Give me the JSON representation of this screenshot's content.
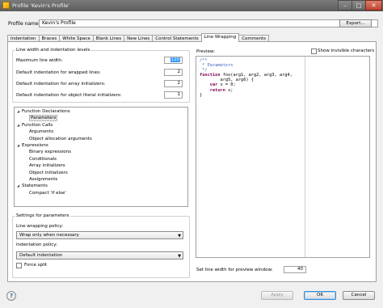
{
  "window": {
    "title": "Profile 'Kevin's Profile'",
    "min_glyph": "–",
    "max_glyph": "□",
    "close_glyph": "✕"
  },
  "profile": {
    "label": "Profile name:",
    "value": "Kevin's Profile",
    "export_label": "Export..."
  },
  "tabs": [
    {
      "label": "Indentation"
    },
    {
      "label": "Braces"
    },
    {
      "label": "White Space"
    },
    {
      "label": "Blank Lines"
    },
    {
      "label": "New Lines"
    },
    {
      "label": "Control Statements"
    },
    {
      "label": "Line Wrapping",
      "active": true
    },
    {
      "label": "Comments"
    }
  ],
  "line_width_group": {
    "title": "Line width and indentation levels",
    "rows": [
      {
        "label": "Maximum line width:",
        "value": "120"
      },
      {
        "label": "Default indentation for wrapped lines:",
        "value": "2"
      },
      {
        "label": "Default indentation for array initializers:",
        "value": "2"
      },
      {
        "label": "Default indentation for object literal initializers:",
        "value": "1"
      }
    ]
  },
  "tree": {
    "nodes": [
      {
        "label": "Function Declarations",
        "level": 0,
        "expanded": true
      },
      {
        "label": "Parameters",
        "level": 1,
        "selected": true
      },
      {
        "label": "Function Calls",
        "level": 0,
        "expanded": true
      },
      {
        "label": "Arguments",
        "level": 1
      },
      {
        "label": "Object allocation arguments",
        "level": 1
      },
      {
        "label": "Expressions",
        "level": 0,
        "expanded": true
      },
      {
        "label": "Binary expressions",
        "level": 1
      },
      {
        "label": "Conditionals",
        "level": 1
      },
      {
        "label": "Array initializers",
        "level": 1
      },
      {
        "label": "Object initializers",
        "level": 1
      },
      {
        "label": "Assignments",
        "level": 1
      },
      {
        "label": "Statements",
        "level": 0,
        "expanded": true
      },
      {
        "label": "Compact 'if else'",
        "level": 1
      }
    ]
  },
  "settings_group": {
    "title": "Settings for parameters",
    "wrapping_policy_label": "Line wrapping policy:",
    "wrapping_policy_value": "Wrap only when necessary",
    "indentation_policy_label": "Indentation policy:",
    "indentation_policy_value": "Default indentation",
    "force_split_label": "Force split",
    "force_split_checked": false
  },
  "preview": {
    "label": "Preview:",
    "show_invisible_label": "Show invisible characters",
    "show_invisible_checked": false,
    "code_lines": [
      {
        "text": "/**",
        "kind": "comment"
      },
      {
        "text": " * Parameters",
        "kind": "comment"
      },
      {
        "text": " */",
        "kind": "comment"
      },
      {
        "text": "function foo(arg1, arg2, arg3, arg4,",
        "kind": "code"
      },
      {
        "text": "        arg5, arg6) {",
        "kind": "code"
      },
      {
        "text": "    var x = 0;",
        "kind": "code"
      },
      {
        "text": "    return x;",
        "kind": "code"
      },
      {
        "text": "}",
        "kind": "code"
      }
    ],
    "line_width_label": "Set line width for preview window:",
    "line_width_value": "40"
  },
  "footer": {
    "help_glyph": "?",
    "apply_label": "Apply",
    "ok_label": "OK",
    "cancel_label": "Cancel"
  }
}
